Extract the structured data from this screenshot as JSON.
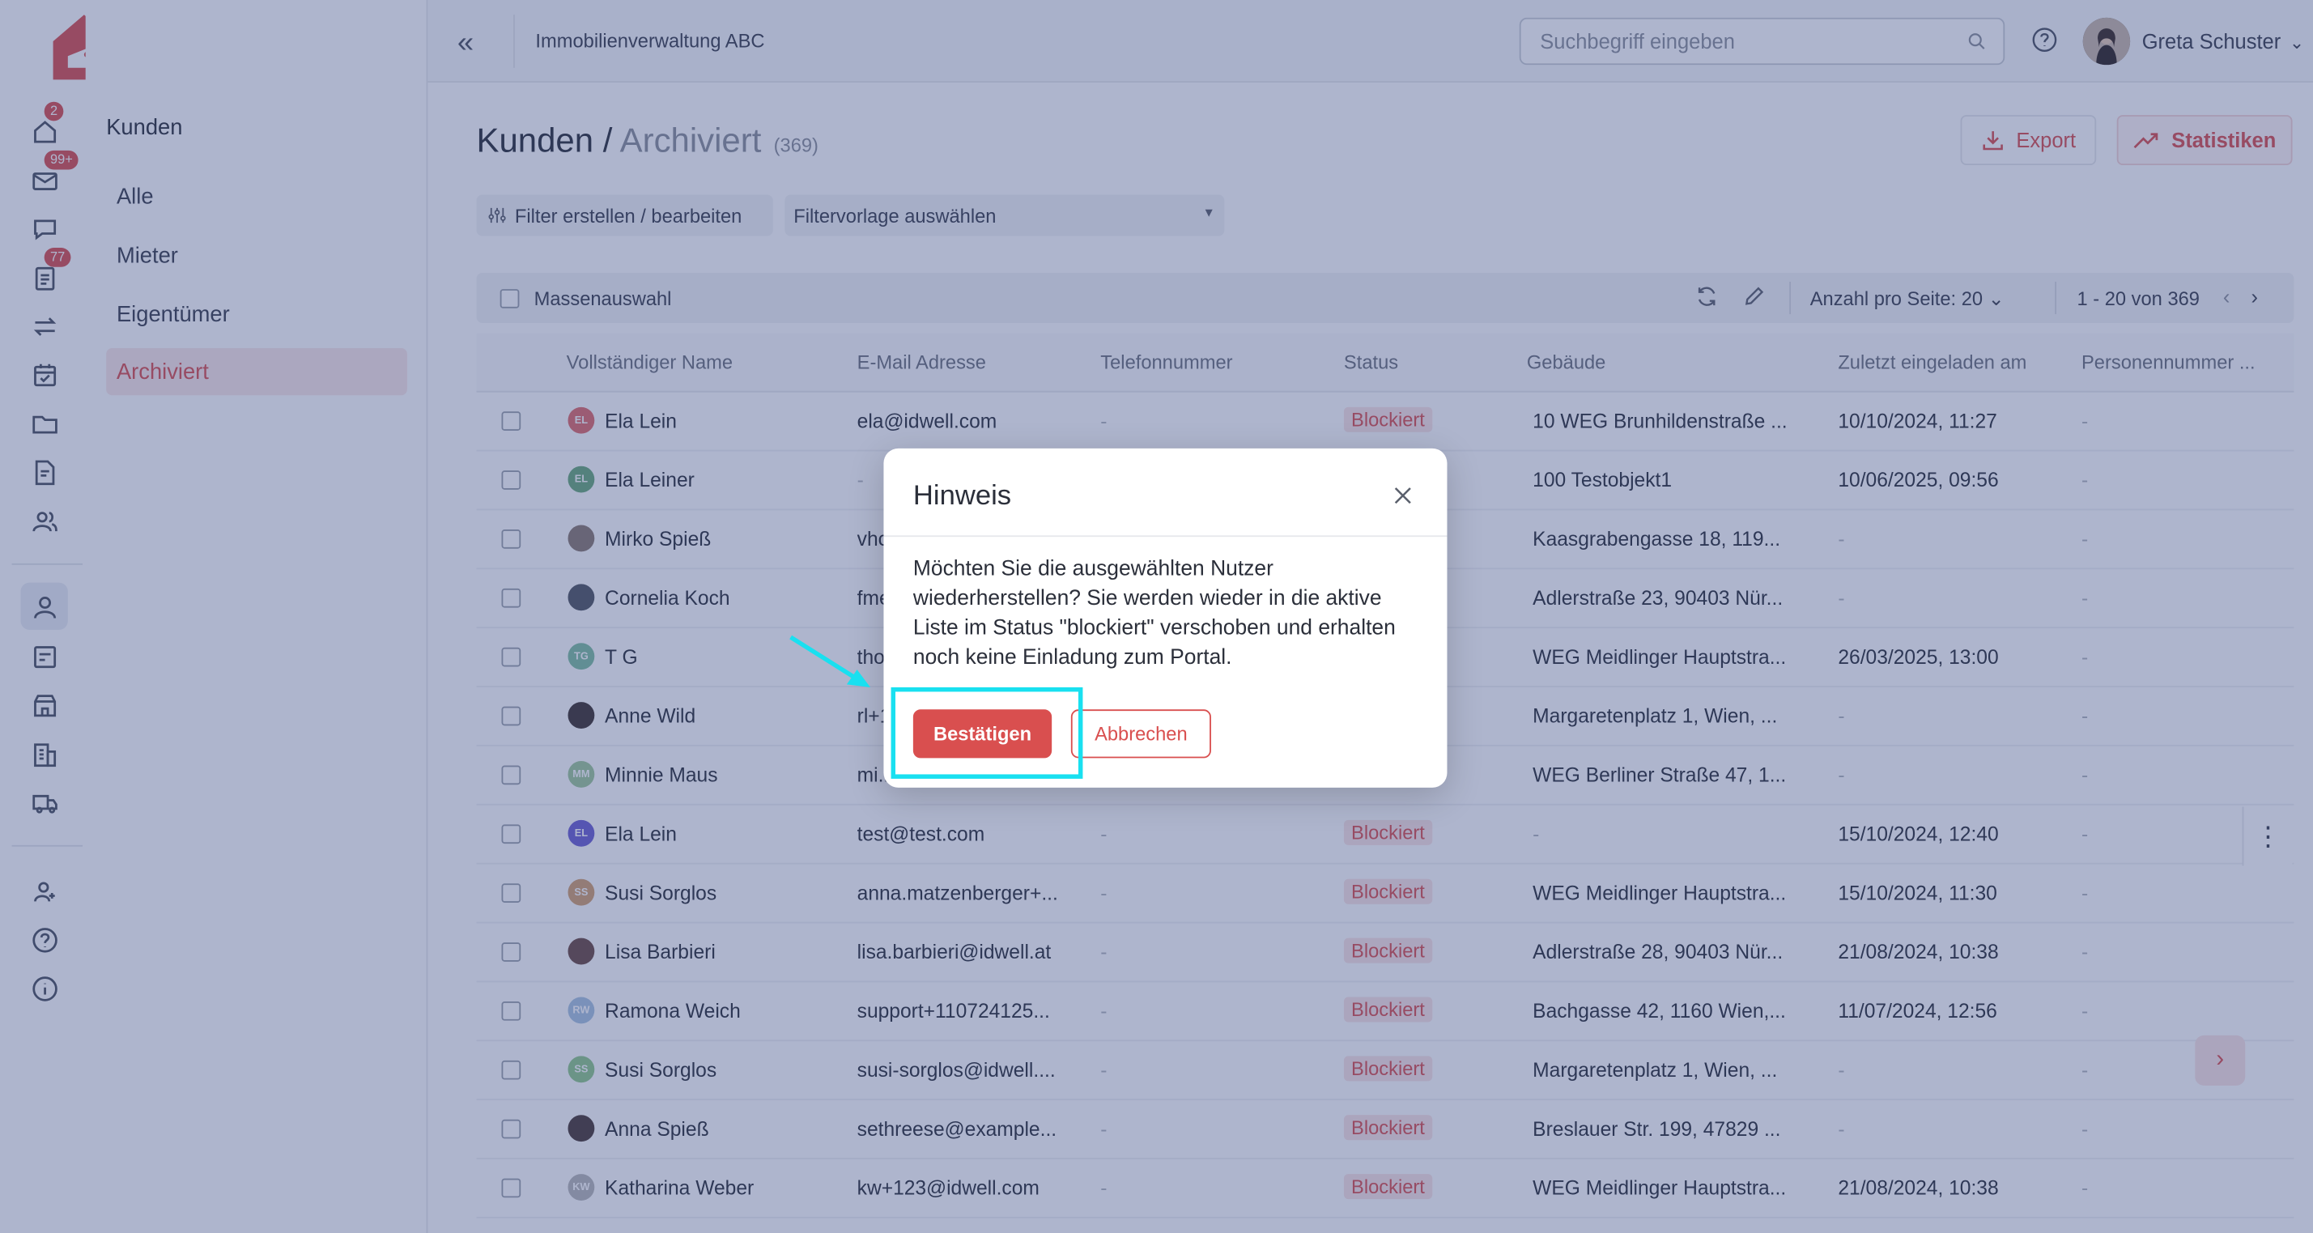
{
  "brand": {
    "name": "idwell",
    "accent": "#d94f4f"
  },
  "rail": {
    "badges": {
      "home": "2",
      "mail": "99+",
      "tasks": "77"
    }
  },
  "subnav": {
    "title": "Kunden",
    "items": [
      {
        "label": "Alle",
        "active": false
      },
      {
        "label": "Mieter",
        "active": false
      },
      {
        "label": "Eigentümer",
        "active": false
      },
      {
        "label": "Archiviert",
        "active": true
      }
    ]
  },
  "topbar": {
    "org_name": "Immobilienverwaltung ABC",
    "search_placeholder": "Suchbegriff eingeben",
    "user_name": "Greta Schuster"
  },
  "page": {
    "crumb_root": "Kunden",
    "crumb_sep": " / ",
    "crumb_current": "Archiviert",
    "count": "(369)",
    "export_label": "Export",
    "stats_label": "Statistiken",
    "filter_button": "Filter erstellen / bearbeiten",
    "filter_template": "Filtervorlage auswählen"
  },
  "toolbar": {
    "mass_select": "Massenauswahl",
    "per_page_label": "Anzahl pro Seite:",
    "per_page_value": "20",
    "range": "1 - 20 von 369"
  },
  "table": {
    "headers": [
      "Vollständiger Name",
      "E-Mail Adresse",
      "Telefonnummer",
      "Status",
      "Gebäude",
      "Zuletzt eingeladen am",
      "Personennummer ..."
    ],
    "rows": [
      {
        "initials": "EL",
        "avatar_color": "#e06b6b",
        "name": "Ela Lein",
        "email": "ela@idwell.com",
        "phone": "-",
        "status": "Blockiert",
        "building": "10 WEG Brunhildenstraße ...",
        "invited": "10/10/2024, 11:27",
        "person_no": "-"
      },
      {
        "initials": "EL",
        "avatar_color": "#6aa97a",
        "name": "Ela Leiner",
        "email": "-",
        "phone": "-",
        "status": "Blockiert",
        "building": "100 Testobjekt1",
        "invited": "10/06/2025, 09:56",
        "person_no": "-"
      },
      {
        "initials": "",
        "avatar_color": "#8a7a70",
        "name": "Mirko Spieß",
        "email": "vhc...",
        "phone": "-",
        "status": "Blockiert",
        "building": "Kaasgrabengasse 18, 119...",
        "invited": "-",
        "person_no": "-"
      },
      {
        "initials": "",
        "avatar_color": "#505660",
        "name": "Cornelia Koch",
        "email": "fme...",
        "phone": "-",
        "status": "Blockiert",
        "building": "Adlerstraße 23, 90403 Nür...",
        "invited": "-",
        "person_no": "-"
      },
      {
        "initials": "TG",
        "avatar_color": "#7fbfa0",
        "name": "T G",
        "email": "tho...",
        "phone": "-",
        "status": "Blockiert",
        "building": "WEG Meidlinger Hauptstra...",
        "invited": "26/03/2025, 13:00",
        "person_no": "-"
      },
      {
        "initials": "",
        "avatar_color": "#3e3330",
        "name": "Anne Wild",
        "email": "rl+1...",
        "phone": "-",
        "status": "Blockiert",
        "building": "Margaretenplatz 1, Wien, ...",
        "invited": "-",
        "person_no": "-"
      },
      {
        "initials": "MM",
        "avatar_color": "#9fc89a",
        "name": "Minnie Maus",
        "email": "mi...",
        "phone": "-",
        "status": "Blockiert",
        "building": "WEG Berliner Straße 47, 1...",
        "invited": "-",
        "person_no": "-"
      },
      {
        "initials": "EL",
        "avatar_color": "#6b5fd3",
        "name": "Ela Lein",
        "email": "test@test.com",
        "phone": "-",
        "status": "Blockiert",
        "building": "-",
        "invited": "15/10/2024, 12:40",
        "person_no": "-"
      },
      {
        "initials": "SS",
        "avatar_color": "#d2a070",
        "name": "Susi Sorglos",
        "email": "anna.matzenberger+...",
        "phone": "-",
        "status": "Blockiert",
        "building": "WEG Meidlinger Hauptstra...",
        "invited": "15/10/2024, 11:30",
        "person_no": "-"
      },
      {
        "initials": "",
        "avatar_color": "#6b4a44",
        "name": "Lisa Barbieri",
        "email": "lisa.barbieri@idwell.at",
        "phone": "-",
        "status": "Blockiert",
        "building": "Adlerstraße 28, 90403 Nür...",
        "invited": "21/08/2024, 10:38",
        "person_no": "-"
      },
      {
        "initials": "RW",
        "avatar_color": "#a9c4e0",
        "name": "Ramona Weich",
        "email": "support+110724125...",
        "phone": "-",
        "status": "Blockiert",
        "building": "Bachgasse 42, 1160 Wien,...",
        "invited": "11/07/2024, 12:56",
        "person_no": "-"
      },
      {
        "initials": "SS",
        "avatar_color": "#8fc88a",
        "name": "Susi Sorglos",
        "email": "susi-sorglos@idwell....",
        "phone": "-",
        "status": "Blockiert",
        "building": "Margaretenplatz 1, Wien, ...",
        "invited": "-",
        "person_no": "-"
      },
      {
        "initials": "",
        "avatar_color": "#4a3a36",
        "name": "Anna Spieß",
        "email": "sethreese@example...",
        "phone": "-",
        "status": "Blockiert",
        "building": "Breslauer Str. 199, 47829 ...",
        "invited": "-",
        "person_no": "-"
      },
      {
        "initials": "KW",
        "avatar_color": "#b8b8b8",
        "name": "Katharina Weber",
        "email": "kw+123@idwell.com",
        "phone": "-",
        "status": "Blockiert",
        "building": "WEG Meidlinger Hauptstra...",
        "invited": "21/08/2024, 10:38",
        "person_no": "-"
      }
    ]
  },
  "dialog": {
    "title": "Hinweis",
    "body": "Möchten Sie die ausgewählten Nutzer wiederherstellen? Sie werden wieder in die aktive Liste im Status \"blockiert\" verschoben und erhalten noch keine Einladung zum Portal.",
    "confirm": "Bestätigen",
    "cancel": "Abbrechen"
  },
  "annotation": {
    "color": "#19e0f0"
  }
}
